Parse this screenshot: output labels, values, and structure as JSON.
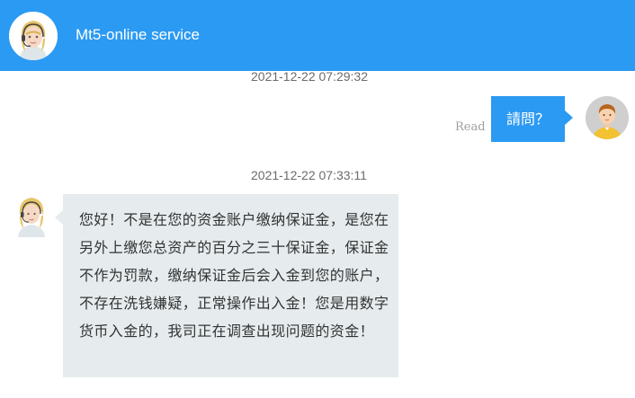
{
  "header": {
    "title": "Mt5-online service",
    "avatar_icon": "support-agent-avatar-icon",
    "background_color": "#2b9af3"
  },
  "messages": [
    {
      "timestamp": "2021-12-22 07:29:32",
      "sender": "user",
      "text": "請問？",
      "status": "Read",
      "avatar_icon": "user-avatar-icon"
    },
    {
      "timestamp": "2021-12-22 07:33:11",
      "sender": "agent",
      "text": "您好！不是在您的资金账户缴纳保证金，是您在另外上缴您总资产的百分之三十保证金，保证金不作为罚款，缴纳保证金后会入金到您的账户，不存在洗钱嫌疑，正常操作出入金！您是用数字货币入金的，我司正在调查出现问题的资金！",
      "avatar_icon": "support-agent-avatar-icon"
    }
  ],
  "colors": {
    "accent": "#2b9af3",
    "agent_bubble": "#e6ecee",
    "timestamp_text": "#6b6b6b",
    "read_status_text": "#a0a0a0"
  }
}
